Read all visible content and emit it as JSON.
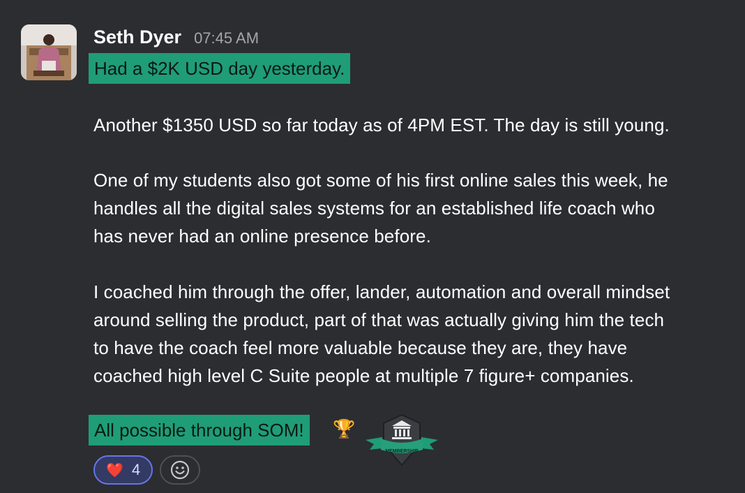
{
  "message": {
    "author": "Seth Dyer",
    "timestamp": "07:45 AM",
    "highlight_first": "Had a $2K USD day yesterday.",
    "lines": [
      "Another $1350 USD so far today as of 4PM EST. The day is still young.",
      "One of my students also got some of his first online sales this week, he",
      "handles all the digital sales systems for an established life coach who",
      "has never had an online presence before.",
      "I coached him through the offer, lander, automation and overall mindset",
      "around selling the product, part of that was actually giving him the tech",
      "to have the coach feel more valuable because they are, they have",
      "coached high level C Suite people at multiple 7 figure+ companies."
    ],
    "highlight_last": "All possible through SOM!",
    "trophy_emoji": "🏆",
    "badge_icon": "membership-badge-icon",
    "badge_label": "MEMBERSHIP"
  },
  "reactions": [
    {
      "emoji": "❤️",
      "count": "4",
      "icon": "heart-icon"
    }
  ],
  "colors": {
    "background": "#2c2d31",
    "highlight": "#1f9d76",
    "reaction_border": "#6875e6",
    "timestamp": "#a3a6aa"
  }
}
